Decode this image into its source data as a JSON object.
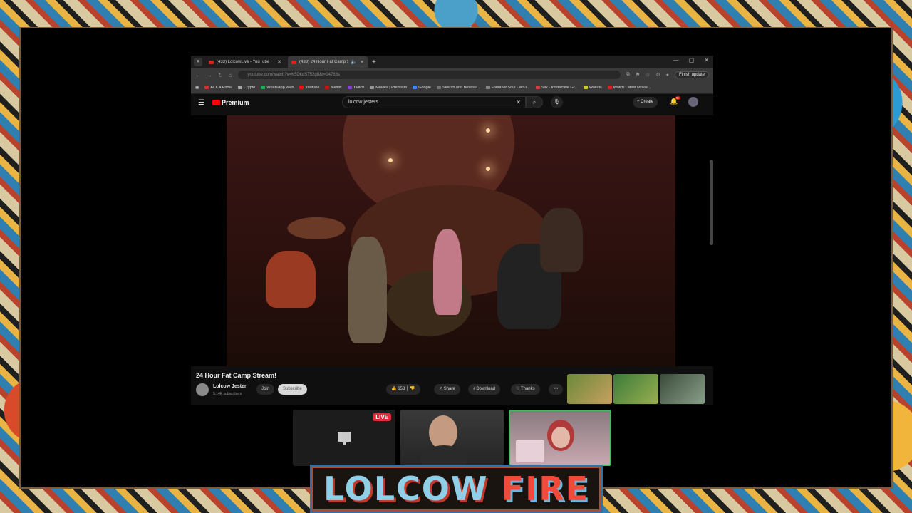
{
  "browser": {
    "tabs": [
      {
        "title": "(433) LolcowLive - YouTube",
        "active": false
      },
      {
        "title": "(433) 24 Hour Fat Camp Str",
        "active": true
      }
    ],
    "url": "youtube.com/watch?v=K5DkdST52g8&t=14783s",
    "finish_update": "Finish update",
    "bookmarks": [
      "ACCA Portal",
      "Crypto",
      "WhatsApp Web",
      "Youtube",
      "Netflix",
      "Twitch",
      "Movies | Premium",
      "Google",
      "Search and Browse...",
      "ForsakenSoul - WoT...",
      "Silk - Interactive Gr...",
      "Wallets",
      "Watch Latest Movie..."
    ]
  },
  "youtube": {
    "logo": "Premium",
    "search_value": "lolcow jesters",
    "create_label": "Create",
    "notif_count": "9+",
    "video_title": "24 Hour Fat Camp Stream!",
    "channel_name": "Lolcow Jester",
    "subscribers": "5.14K subscribers",
    "join_label": "Join",
    "subscribe_label": "Subscribe",
    "likes": "653",
    "share_label": "Share",
    "download_label": "Download",
    "thanks_label": "Thanks",
    "more_label": "•••"
  },
  "stream": {
    "live_label": "LIVE",
    "banner_word1": "LOLCOW",
    "banner_word2": "FIRE"
  },
  "colors": {
    "yt_red": "#ff0000",
    "live_red": "#e02b3a",
    "cam_active_border": "#3dbd5d"
  }
}
